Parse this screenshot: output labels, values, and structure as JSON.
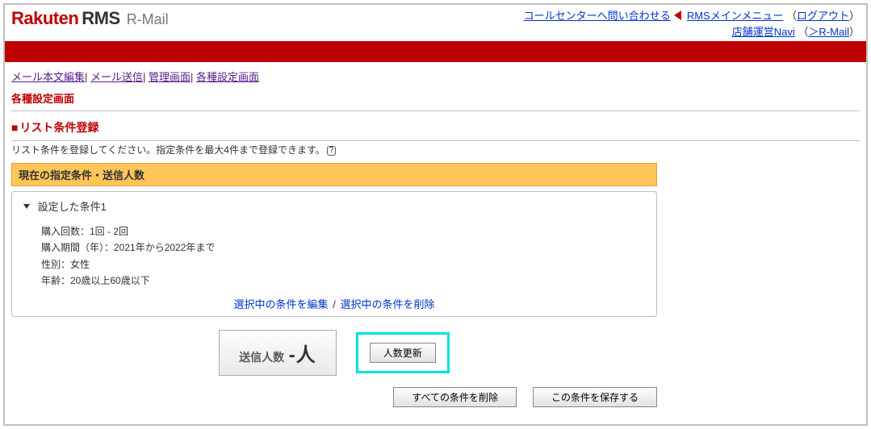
{
  "header": {
    "logo": {
      "brand": "Rakuten",
      "rms": "RMS",
      "sub": "R-Mail"
    },
    "links": {
      "call_center": "コールセンターへ問い合わせる",
      "main_menu": "RMSメインメニュー",
      "logout": "ログアウト",
      "shop_navi": "店舗運営Navi",
      "rmail_link": "＞R-Mail"
    }
  },
  "nav": {
    "mail_body_edit": "メール本文編集",
    "mail_send": "メール送信",
    "admin": "管理画面",
    "settings": "各種設定画面"
  },
  "page_title": "各種設定画面",
  "section_title": "リスト条件登録",
  "instruction": "リスト条件を登録してください。指定条件を最大4件まで登録できます。",
  "cond_bar": "現在の指定条件・送信人数",
  "cond": {
    "title": "設定した条件1",
    "rows": {
      "r1": "購入回数：1回 - 2回",
      "r2": "購入期間（年）：2021年から2022年まで",
      "r3": "性別：女性",
      "r4": "年齢：20歳以上60歳以下"
    },
    "edit": "選択中の条件を編集",
    "del": "選択中の条件を削除"
  },
  "count": {
    "label": "送信人数",
    "value": "-人",
    "update_btn": "人数更新"
  },
  "bottom": {
    "delete_all": "すべての条件を削除",
    "save": "この条件を保存する"
  }
}
